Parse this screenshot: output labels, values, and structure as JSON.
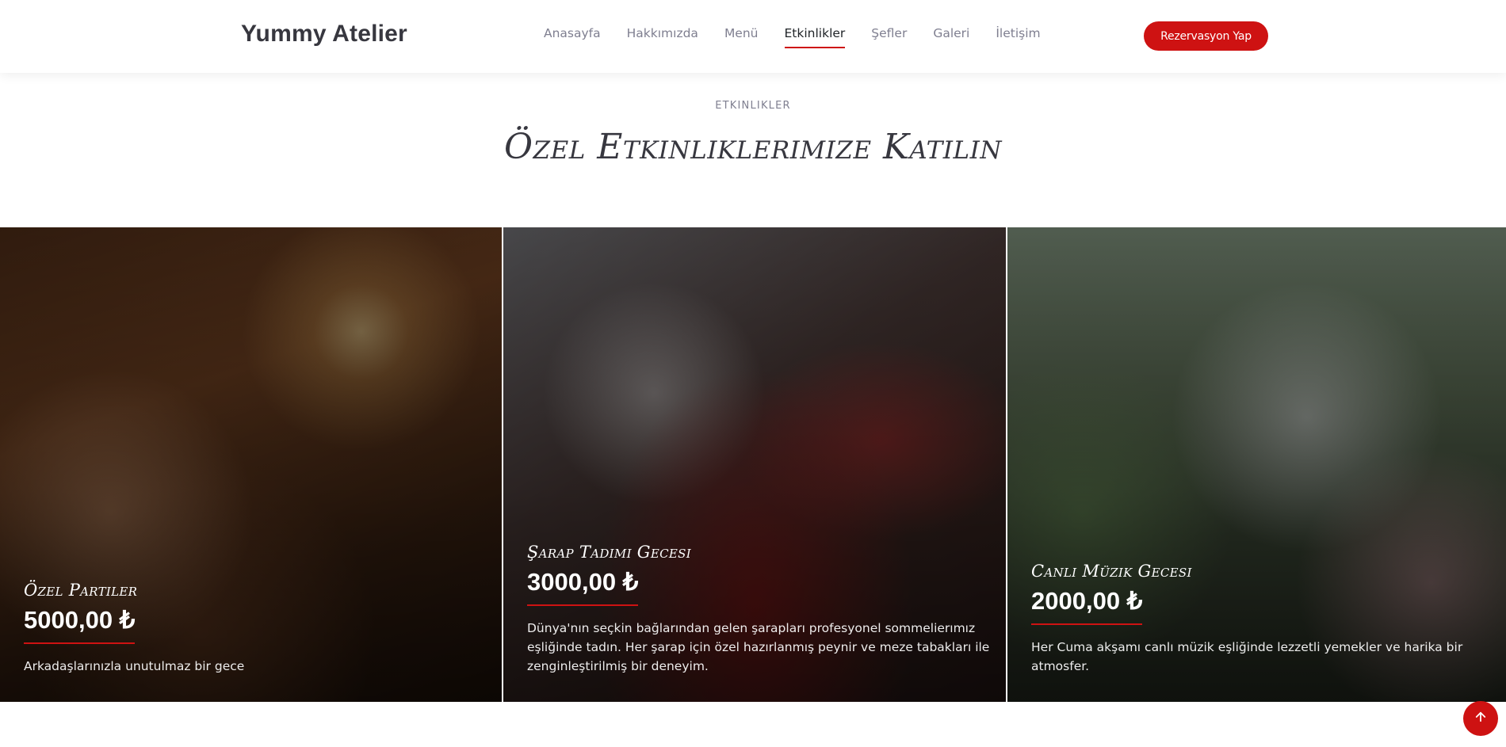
{
  "header": {
    "logo": "Yummy Atelier",
    "nav": [
      {
        "label": "Anasayfa",
        "active": false
      },
      {
        "label": "Hakkımızda",
        "active": false
      },
      {
        "label": "Menü",
        "active": false
      },
      {
        "label": "Etkinlikler",
        "active": true
      },
      {
        "label": "Şefler",
        "active": false
      },
      {
        "label": "Galeri",
        "active": false
      },
      {
        "label": "İletişim",
        "active": false
      }
    ],
    "cta_label": "Rezervasyon Yap"
  },
  "section": {
    "kicker": "ETKINLIKLER",
    "title": "Özel Etkinliklerimize Katılın"
  },
  "events": [
    {
      "title": "Özel Partiler",
      "price": "5000,00 ₺",
      "description": "Arkadaşlarınızla unutulmaz bir gece"
    },
    {
      "title": "Şarap Tadımı Gecesi",
      "price": "3000,00 ₺",
      "description": "Dünya'nın seçkin bağlarından gelen şarapları profesyonel sommelierımız eşliğinde tadın. Her şarap için özel hazırlanmış peynir ve meze tabakları ile zenginleştirilmiş bir deneyim."
    },
    {
      "title": "Canlı Müzik Gecesi",
      "price": "2000,00 ₺",
      "description": "Her Cuma akşamı canlı müzik eşliğinde lezzetli yemekler ve harika bir atmosfer."
    }
  ],
  "colors": {
    "accent": "#ce1212",
    "heading": "#37373f",
    "muted": "#7f7f90"
  },
  "scroll_top_icon": "arrow-up-icon"
}
